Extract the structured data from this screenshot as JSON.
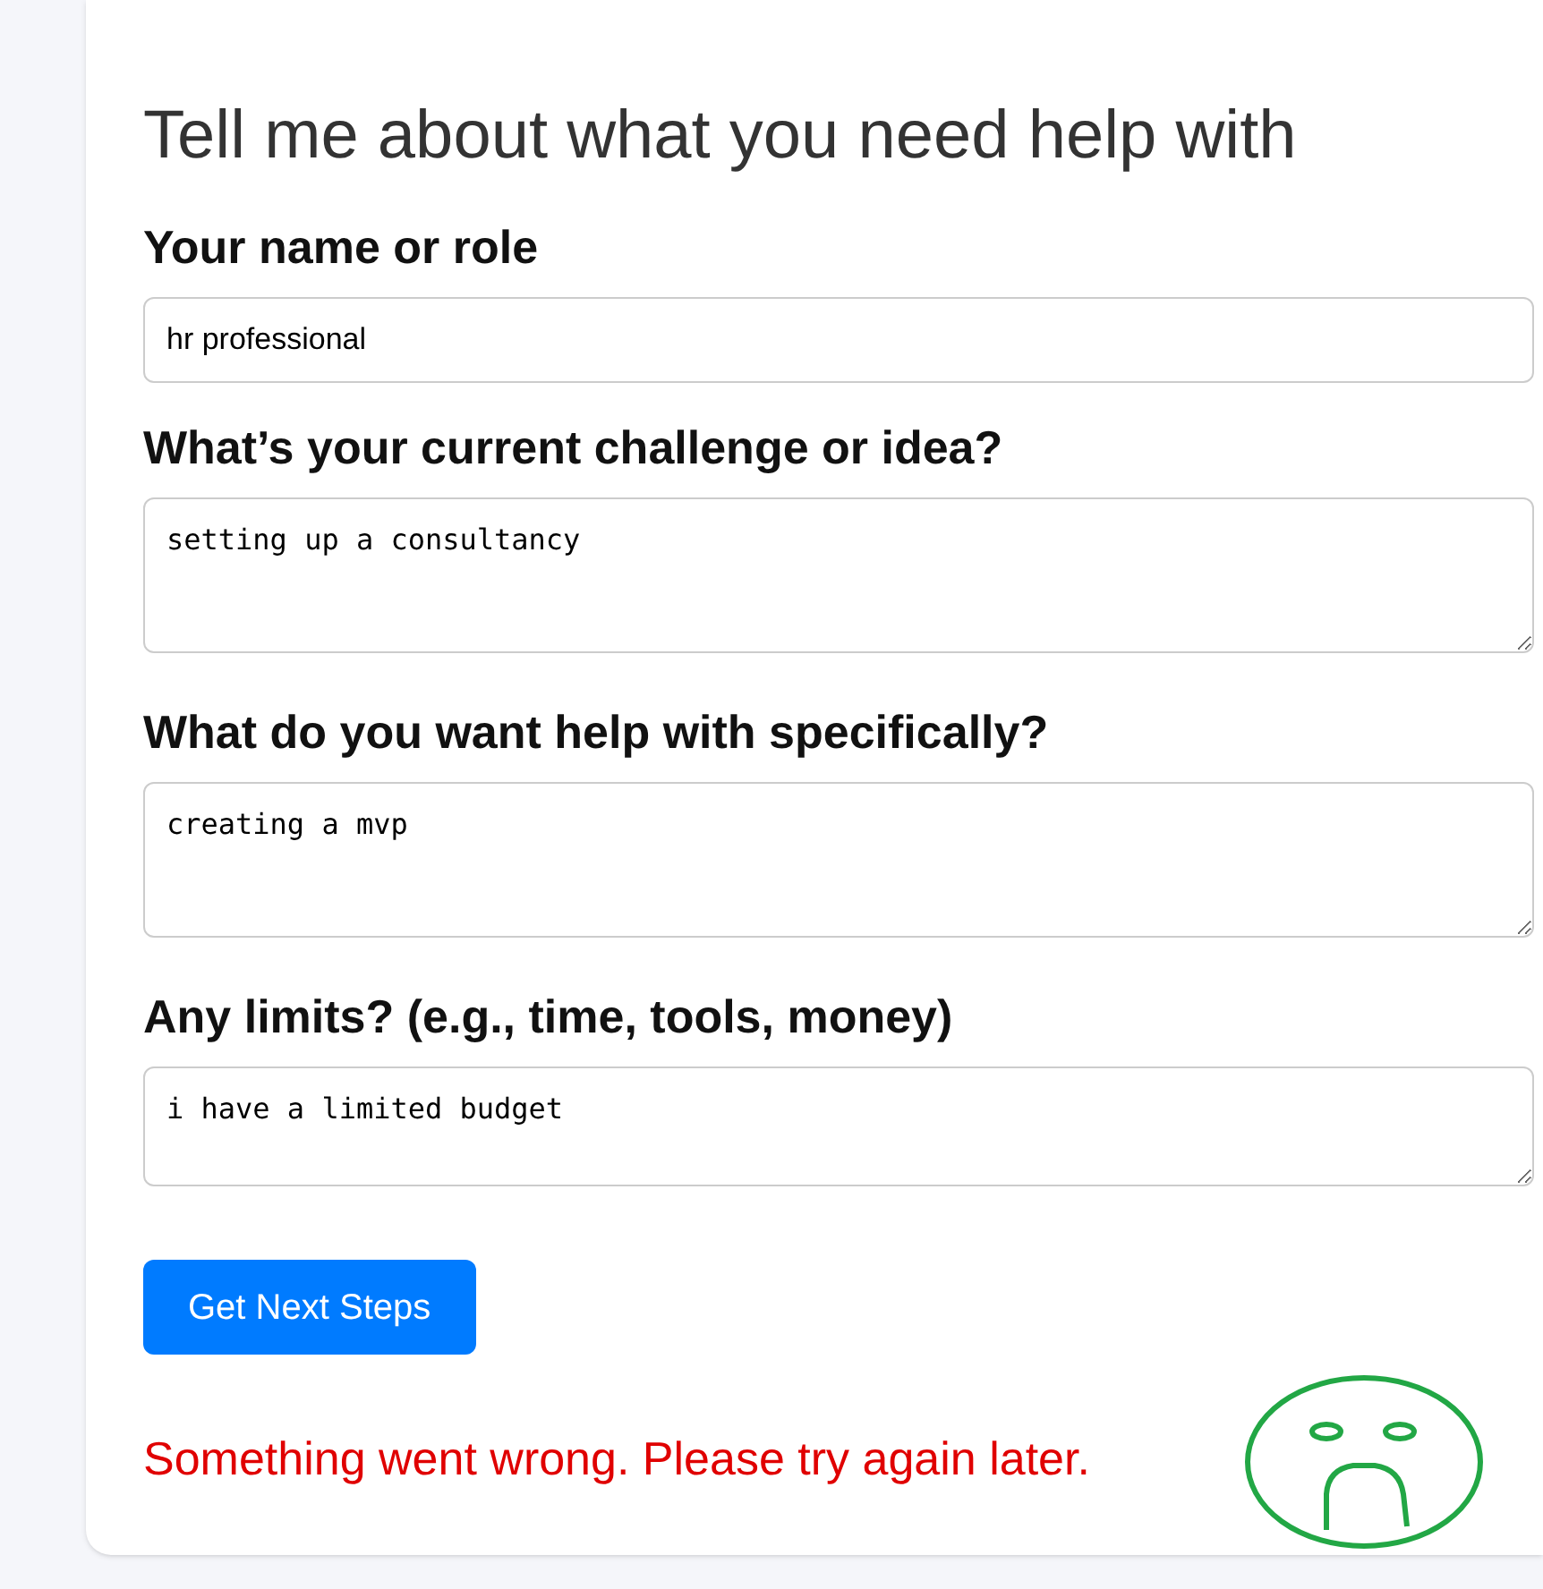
{
  "title": "Tell me about what you need help with",
  "fields": [
    {
      "label": "Your name or role",
      "kind": "input",
      "value": "hr professional"
    },
    {
      "label": "What’s your current challenge or idea?",
      "kind": "textarea",
      "value": "setting up a consultancy"
    },
    {
      "label": "What do you want help with specifically?",
      "kind": "textarea",
      "value": "creating a mvp"
    },
    {
      "label": "Any limits? (e.g., time, tools, money)",
      "kind": "textarea",
      "value": "i have a limited budget"
    }
  ],
  "submit_button": "Get Next Steps",
  "error_message": "Something went wrong. Please try again later."
}
